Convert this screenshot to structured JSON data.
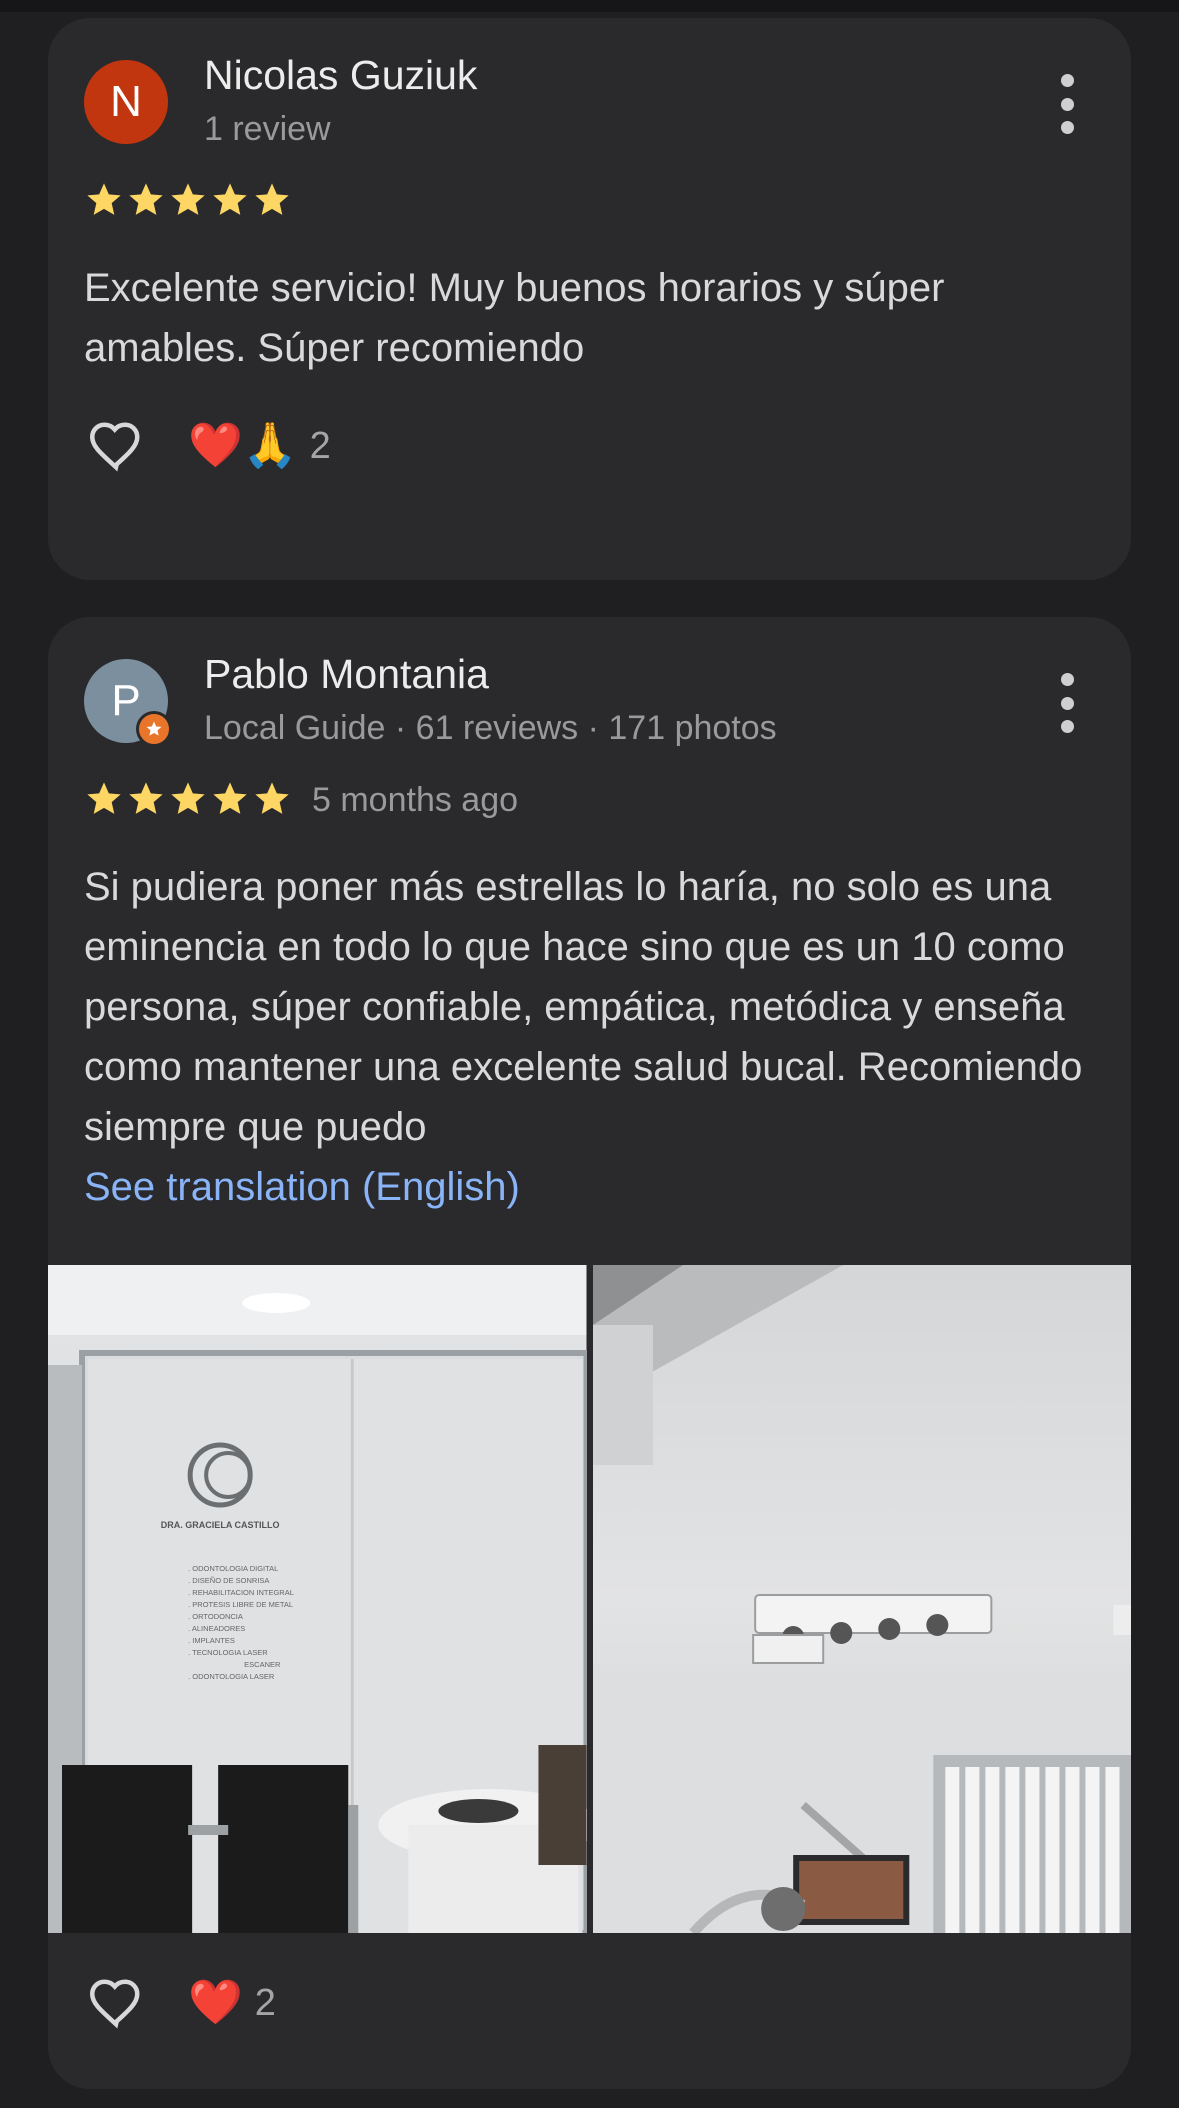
{
  "reviews": [
    {
      "author_initial": "N",
      "author": "Nicolas Guziuk",
      "meta": "1 review",
      "rating": 5,
      "time": "",
      "text": "Excelente servicio! Muy buenos horarios y súper amables. Súper recomiendo",
      "reactions_emoji": "❤️🙏",
      "reactions_count": "2",
      "avatar_color": "#c1360f"
    },
    {
      "author_initial": "P",
      "author": "Pablo Montania",
      "meta": "Local Guide · 61 reviews · 171 photos",
      "rating": 5,
      "time": "5 months ago",
      "text": "Si pudiera poner más estrellas lo haría, no solo es una eminencia en todo lo que hace sino que es un 10 como persona, súper confiable, empática, metódica y enseña como mantener una excelente salud bucal. Recomiendo siempre que puedo",
      "translation_link": "See translation (English)",
      "reactions_emoji": "❤️",
      "reactions_count": "2",
      "avatar_color": "#7c8f9e",
      "photo_sign": {
        "clinic_name": "DRA. GRACIELA CASTILLO",
        "services": [
          ". ODONTOLOGIA DIGITAL",
          ". DISEÑO DE SONRISA",
          ". REHABILITACION INTEGRAL",
          ". PROTESIS LIBRE DE METAL",
          ". ORTODONCIA",
          ". ALINEADORES",
          ". IMPLANTES",
          ". TECNOLOGIA LASER",
          "ESCANER",
          ". ODONTOLOGIA LASER"
        ]
      }
    }
  ],
  "colors": {
    "star": "#fdd663",
    "link": "#8ab4f8",
    "card_bg": "#2a2a2c",
    "page_bg": "#1f1f21"
  },
  "icons": [
    "more-vert-icon",
    "star-icon",
    "heart-outline-icon",
    "local-guide-badge-icon"
  ]
}
